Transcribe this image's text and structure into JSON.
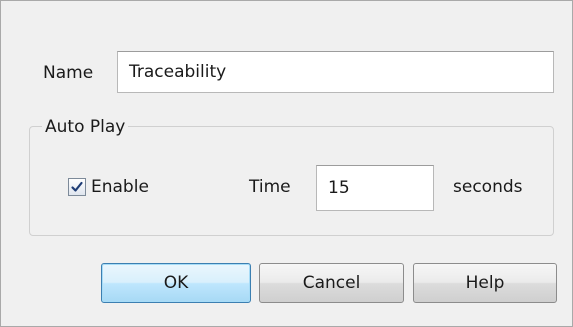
{
  "name_field": {
    "label": "Name",
    "value": "Traceability"
  },
  "auto_play": {
    "group_title": "Auto Play",
    "enable_label": "Enable",
    "enable_checked": true,
    "time_label": "Time",
    "time_value": "15",
    "unit_label": "seconds"
  },
  "buttons": {
    "ok": "OK",
    "cancel": "Cancel",
    "help": "Help"
  },
  "colors": {
    "dialog_background": "#f0f0f0",
    "default_button_border": "#3c7fb1",
    "checkmark": "#1f3d75"
  },
  "icons": {
    "checkbox": "checkmark-icon"
  }
}
